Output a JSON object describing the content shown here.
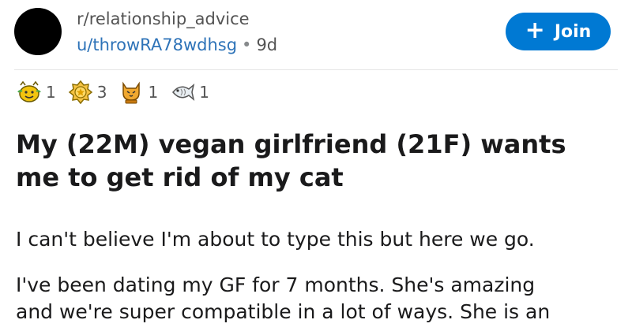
{
  "post": {
    "subreddit": "r/relationship_advice",
    "username": "u/throwRA78wdhsg",
    "separator": "•",
    "age": "9d",
    "join_label": "Join",
    "join_icon": "plus-icon",
    "awards": [
      {
        "icon": "wholesome-award-icon",
        "count": "1"
      },
      {
        "icon": "gold-medal-award-icon",
        "count": "3"
      },
      {
        "icon": "cat-award-icon",
        "count": "1"
      },
      {
        "icon": "fish-award-icon",
        "count": "1"
      }
    ],
    "title": "My (22M) vegan girlfriend (21F) wants me to get rid of my cat",
    "paragraphs": [
      "I can't believe I'm about to type this but here we go.",
      "I've been dating my GF for 7 months. She's amazing",
      "and we're super compatible in a lot of ways. She is an"
    ]
  },
  "colors": {
    "join_button": "#0079d3",
    "username": "#2e73b8",
    "avatar": "#000000"
  }
}
